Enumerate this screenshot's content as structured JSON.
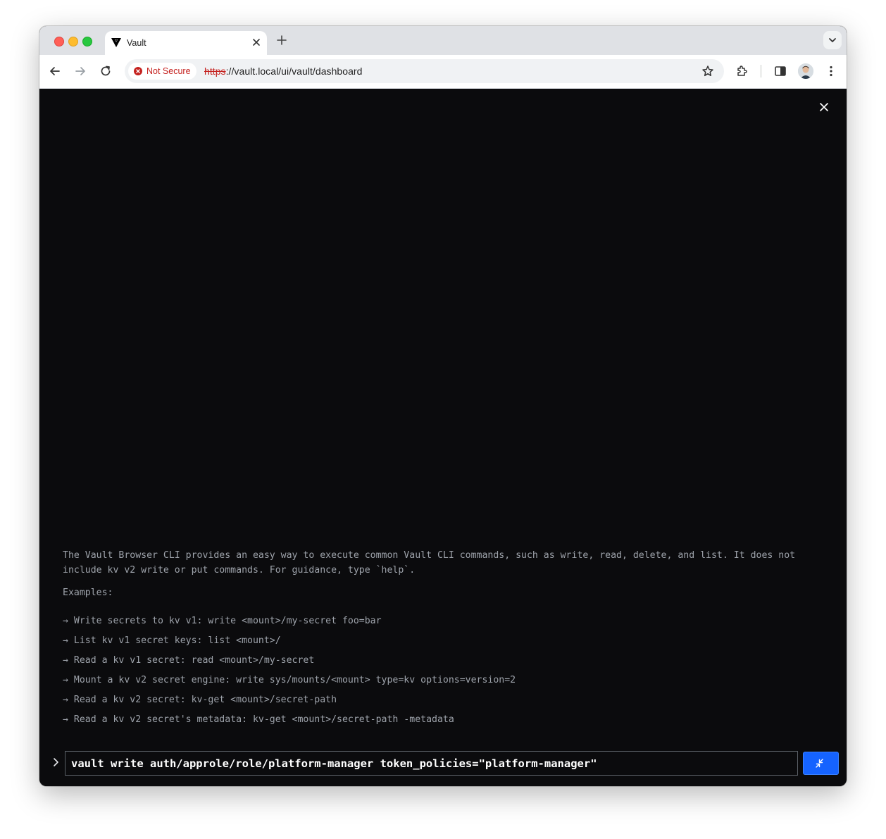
{
  "browser": {
    "tab": {
      "title": "Vault",
      "favicon": "vault-triangle-icon"
    },
    "new_tab_icon": "plus-icon",
    "security_label": "Not Secure",
    "url_scheme": "https",
    "url_rest": "://vault.local/ui/vault/dashboard"
  },
  "console": {
    "intro": "The Vault Browser CLI provides an easy way to execute common Vault CLI commands, such as write, read, delete, and list. It does not include kv v2 write or put commands. For guidance, type `help`.",
    "examples_label": "Examples:",
    "examples": [
      "→ Write secrets to kv v1: write <mount>/my-secret foo=bar",
      "→ List kv v1 secret keys: list <mount>/",
      "→ Read a kv v1 secret: read <mount>/my-secret",
      "→ Mount a kv v2 secret engine: write sys/mounts/<mount> type=kv options=version=2",
      "→ Read a kv v2 secret: kv-get <mount>/secret-path",
      "→ Read a kv v2 secret's metadata: kv-get <mount>/secret-path -metadata"
    ],
    "command_value": "vault write auth/approle/role/platform-manager token_policies=\"platform-manager\""
  },
  "colors": {
    "console_bg": "#0b0b0d",
    "console_text": "#9ea3ab",
    "accent_blue": "#1563ff",
    "insecure_red": "#c5221f"
  }
}
